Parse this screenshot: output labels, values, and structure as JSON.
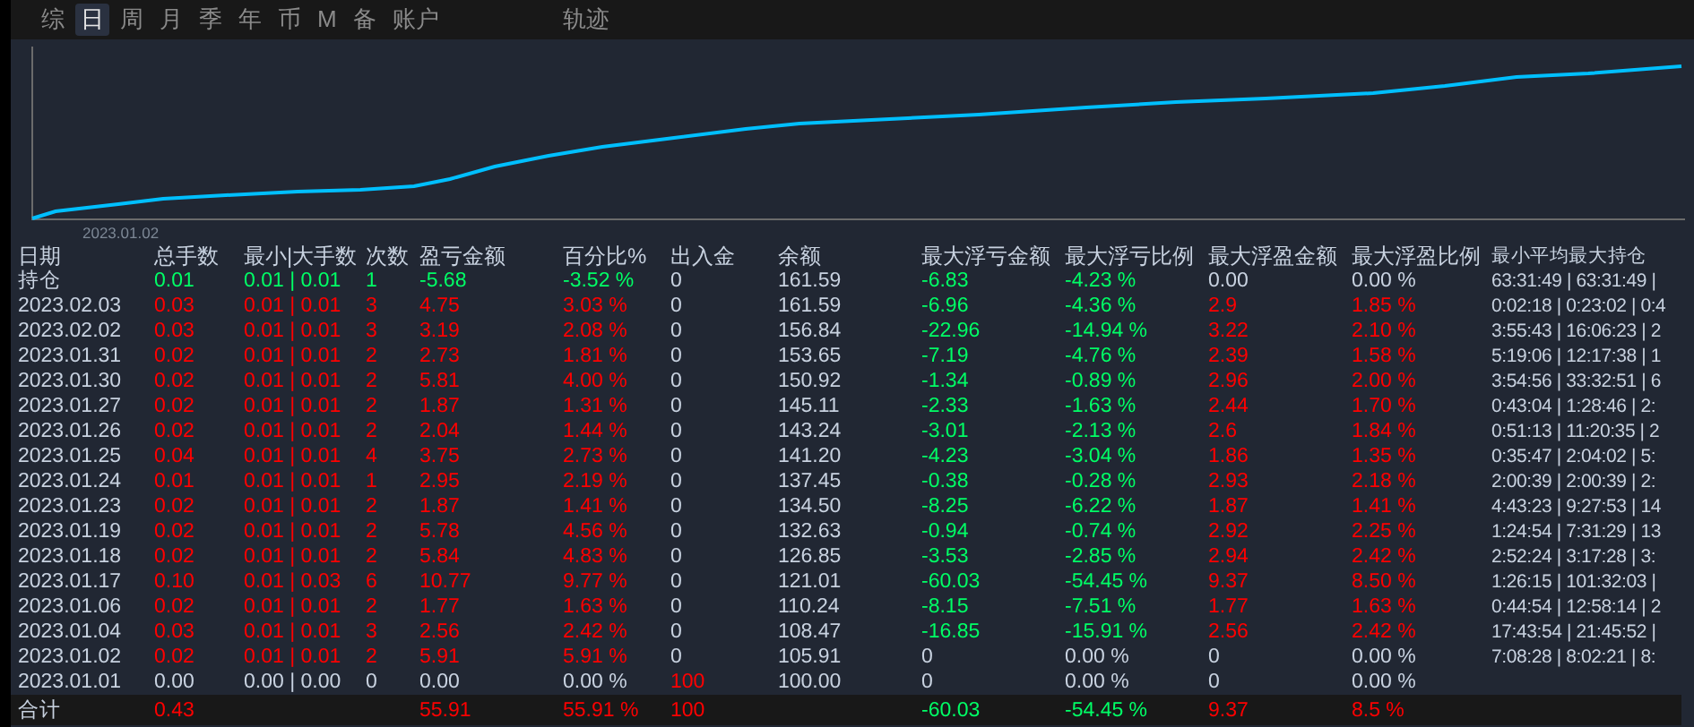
{
  "tabs": [
    {
      "label": "综",
      "selected": false
    },
    {
      "label": "日",
      "selected": true
    },
    {
      "label": "周",
      "selected": false
    },
    {
      "label": "月",
      "selected": false
    },
    {
      "label": "季",
      "selected": false
    },
    {
      "label": "年",
      "selected": false
    },
    {
      "label": "币",
      "selected": false
    },
    {
      "label": "M",
      "selected": false
    },
    {
      "label": "备",
      "selected": false
    },
    {
      "label": "账户",
      "selected": false
    }
  ],
  "side_tab": {
    "label": "轨迹",
    "selected": false
  },
  "chart": {
    "date_label": "2023.01.02"
  },
  "table": {
    "columns": [
      "日期",
      "总手数",
      "最小|大手数",
      "次数",
      "盈亏金额",
      "百分比%",
      "出入金",
      "余额",
      "最大浮亏金额",
      "最大浮亏比例",
      "最大浮盈金额",
      "最大浮盈比例",
      "最小平均最大持仓"
    ],
    "rows": [
      {
        "cells": [
          {
            "text": "持仓",
            "color": "#c8d2e0"
          },
          {
            "text": "0.01",
            "color": "#00ff66"
          },
          {
            "text": "0.01 | 0.01",
            "color": "#00ff66"
          },
          {
            "text": "1",
            "color": "#00ff66"
          },
          {
            "text": "-5.68",
            "color": "#00ff66"
          },
          {
            "text": "-3.52 %",
            "color": "#00ff66"
          },
          {
            "text": "0",
            "color": "#c8d2e0"
          },
          {
            "text": "161.59",
            "color": "#c8d2e0"
          },
          {
            "text": "-6.83",
            "color": "#00ff66"
          },
          {
            "text": "-4.23 %",
            "color": "#00ff66"
          },
          {
            "text": "0.00",
            "color": "#c8d2e0"
          },
          {
            "text": "0.00 %",
            "color": "#c8d2e0"
          },
          {
            "text": "63:31:49 | 63:31:49 |",
            "color": "#c8d2e0"
          }
        ]
      },
      {
        "cells": [
          {
            "text": "2023.02.03",
            "color": "#c8d2e0"
          },
          {
            "text": "0.03",
            "color": "#ff0000"
          },
          {
            "text": "0.01 | 0.01",
            "color": "#ff0000"
          },
          {
            "text": "3",
            "color": "#ff0000"
          },
          {
            "text": "4.75",
            "color": "#ff0000"
          },
          {
            "text": "3.03 %",
            "color": "#ff0000"
          },
          {
            "text": "0",
            "color": "#c8d2e0"
          },
          {
            "text": "161.59",
            "color": "#c8d2e0"
          },
          {
            "text": "-6.96",
            "color": "#00ff66"
          },
          {
            "text": "-4.36 %",
            "color": "#00ff66"
          },
          {
            "text": "2.9",
            "color": "#ff0000"
          },
          {
            "text": "1.85 %",
            "color": "#ff0000"
          },
          {
            "text": "0:02:18 | 0:23:02 | 0:4",
            "color": "#c8d2e0"
          }
        ]
      },
      {
        "cells": [
          {
            "text": "2023.02.02",
            "color": "#c8d2e0"
          },
          {
            "text": "0.03",
            "color": "#ff0000"
          },
          {
            "text": "0.01 | 0.01",
            "color": "#ff0000"
          },
          {
            "text": "3",
            "color": "#ff0000"
          },
          {
            "text": "3.19",
            "color": "#ff0000"
          },
          {
            "text": "2.08 %",
            "color": "#ff0000"
          },
          {
            "text": "0",
            "color": "#c8d2e0"
          },
          {
            "text": "156.84",
            "color": "#c8d2e0"
          },
          {
            "text": "-22.96",
            "color": "#00ff66"
          },
          {
            "text": "-14.94 %",
            "color": "#00ff66"
          },
          {
            "text": "3.22",
            "color": "#ff0000"
          },
          {
            "text": "2.10 %",
            "color": "#ff0000"
          },
          {
            "text": "3:55:43 | 16:06:23 | 2",
            "color": "#c8d2e0"
          }
        ]
      },
      {
        "cells": [
          {
            "text": "2023.01.31",
            "color": "#c8d2e0"
          },
          {
            "text": "0.02",
            "color": "#ff0000"
          },
          {
            "text": "0.01 | 0.01",
            "color": "#ff0000"
          },
          {
            "text": "2",
            "color": "#ff0000"
          },
          {
            "text": "2.73",
            "color": "#ff0000"
          },
          {
            "text": "1.81 %",
            "color": "#ff0000"
          },
          {
            "text": "0",
            "color": "#c8d2e0"
          },
          {
            "text": "153.65",
            "color": "#c8d2e0"
          },
          {
            "text": "-7.19",
            "color": "#00ff66"
          },
          {
            "text": "-4.76 %",
            "color": "#00ff66"
          },
          {
            "text": "2.39",
            "color": "#ff0000"
          },
          {
            "text": "1.58 %",
            "color": "#ff0000"
          },
          {
            "text": "5:19:06 | 12:17:38 | 1",
            "color": "#c8d2e0"
          }
        ]
      },
      {
        "cells": [
          {
            "text": "2023.01.30",
            "color": "#c8d2e0"
          },
          {
            "text": "0.02",
            "color": "#ff0000"
          },
          {
            "text": "0.01 | 0.01",
            "color": "#ff0000"
          },
          {
            "text": "2",
            "color": "#ff0000"
          },
          {
            "text": "5.81",
            "color": "#ff0000"
          },
          {
            "text": "4.00 %",
            "color": "#ff0000"
          },
          {
            "text": "0",
            "color": "#c8d2e0"
          },
          {
            "text": "150.92",
            "color": "#c8d2e0"
          },
          {
            "text": "-1.34",
            "color": "#00ff66"
          },
          {
            "text": "-0.89 %",
            "color": "#00ff66"
          },
          {
            "text": "2.96",
            "color": "#ff0000"
          },
          {
            "text": "2.00 %",
            "color": "#ff0000"
          },
          {
            "text": "3:54:56 | 33:32:51 | 6",
            "color": "#c8d2e0"
          }
        ]
      },
      {
        "cells": [
          {
            "text": "2023.01.27",
            "color": "#c8d2e0"
          },
          {
            "text": "0.02",
            "color": "#ff0000"
          },
          {
            "text": "0.01 | 0.01",
            "color": "#ff0000"
          },
          {
            "text": "2",
            "color": "#ff0000"
          },
          {
            "text": "1.87",
            "color": "#ff0000"
          },
          {
            "text": "1.31 %",
            "color": "#ff0000"
          },
          {
            "text": "0",
            "color": "#c8d2e0"
          },
          {
            "text": "145.11",
            "color": "#c8d2e0"
          },
          {
            "text": "-2.33",
            "color": "#00ff66"
          },
          {
            "text": "-1.63 %",
            "color": "#00ff66"
          },
          {
            "text": "2.44",
            "color": "#ff0000"
          },
          {
            "text": "1.70 %",
            "color": "#ff0000"
          },
          {
            "text": "0:43:04 | 1:28:46 | 2:",
            "color": "#c8d2e0"
          }
        ]
      },
      {
        "cells": [
          {
            "text": "2023.01.26",
            "color": "#c8d2e0"
          },
          {
            "text": "0.02",
            "color": "#ff0000"
          },
          {
            "text": "0.01 | 0.01",
            "color": "#ff0000"
          },
          {
            "text": "2",
            "color": "#ff0000"
          },
          {
            "text": "2.04",
            "color": "#ff0000"
          },
          {
            "text": "1.44 %",
            "color": "#ff0000"
          },
          {
            "text": "0",
            "color": "#c8d2e0"
          },
          {
            "text": "143.24",
            "color": "#c8d2e0"
          },
          {
            "text": "-3.01",
            "color": "#00ff66"
          },
          {
            "text": "-2.13 %",
            "color": "#00ff66"
          },
          {
            "text": "2.6",
            "color": "#ff0000"
          },
          {
            "text": "1.84 %",
            "color": "#ff0000"
          },
          {
            "text": "0:51:13 | 11:20:35 | 2",
            "color": "#c8d2e0"
          }
        ]
      },
      {
        "cells": [
          {
            "text": "2023.01.25",
            "color": "#c8d2e0"
          },
          {
            "text": "0.04",
            "color": "#ff0000"
          },
          {
            "text": "0.01 | 0.01",
            "color": "#ff0000"
          },
          {
            "text": "4",
            "color": "#ff0000"
          },
          {
            "text": "3.75",
            "color": "#ff0000"
          },
          {
            "text": "2.73 %",
            "color": "#ff0000"
          },
          {
            "text": "0",
            "color": "#c8d2e0"
          },
          {
            "text": "141.20",
            "color": "#c8d2e0"
          },
          {
            "text": "-4.23",
            "color": "#00ff66"
          },
          {
            "text": "-3.04 %",
            "color": "#00ff66"
          },
          {
            "text": "1.86",
            "color": "#ff0000"
          },
          {
            "text": "1.35 %",
            "color": "#ff0000"
          },
          {
            "text": "0:35:47 | 2:04:02 | 5:",
            "color": "#c8d2e0"
          }
        ]
      },
      {
        "cells": [
          {
            "text": "2023.01.24",
            "color": "#c8d2e0"
          },
          {
            "text": "0.01",
            "color": "#ff0000"
          },
          {
            "text": "0.01 | 0.01",
            "color": "#ff0000"
          },
          {
            "text": "1",
            "color": "#ff0000"
          },
          {
            "text": "2.95",
            "color": "#ff0000"
          },
          {
            "text": "2.19 %",
            "color": "#ff0000"
          },
          {
            "text": "0",
            "color": "#c8d2e0"
          },
          {
            "text": "137.45",
            "color": "#c8d2e0"
          },
          {
            "text": "-0.38",
            "color": "#00ff66"
          },
          {
            "text": "-0.28 %",
            "color": "#00ff66"
          },
          {
            "text": "2.93",
            "color": "#ff0000"
          },
          {
            "text": "2.18 %",
            "color": "#ff0000"
          },
          {
            "text": "2:00:39 | 2:00:39 | 2:",
            "color": "#c8d2e0"
          }
        ]
      },
      {
        "cells": [
          {
            "text": "2023.01.23",
            "color": "#c8d2e0"
          },
          {
            "text": "0.02",
            "color": "#ff0000"
          },
          {
            "text": "0.01 | 0.01",
            "color": "#ff0000"
          },
          {
            "text": "2",
            "color": "#ff0000"
          },
          {
            "text": "1.87",
            "color": "#ff0000"
          },
          {
            "text": "1.41 %",
            "color": "#ff0000"
          },
          {
            "text": "0",
            "color": "#c8d2e0"
          },
          {
            "text": "134.50",
            "color": "#c8d2e0"
          },
          {
            "text": "-8.25",
            "color": "#00ff66"
          },
          {
            "text": "-6.22 %",
            "color": "#00ff66"
          },
          {
            "text": "1.87",
            "color": "#ff0000"
          },
          {
            "text": "1.41 %",
            "color": "#ff0000"
          },
          {
            "text": "4:43:23 | 9:27:53 | 14",
            "color": "#c8d2e0"
          }
        ]
      },
      {
        "cells": [
          {
            "text": "2023.01.19",
            "color": "#c8d2e0"
          },
          {
            "text": "0.02",
            "color": "#ff0000"
          },
          {
            "text": "0.01 | 0.01",
            "color": "#ff0000"
          },
          {
            "text": "2",
            "color": "#ff0000"
          },
          {
            "text": "5.78",
            "color": "#ff0000"
          },
          {
            "text": "4.56 %",
            "color": "#ff0000"
          },
          {
            "text": "0",
            "color": "#c8d2e0"
          },
          {
            "text": "132.63",
            "color": "#c8d2e0"
          },
          {
            "text": "-0.94",
            "color": "#00ff66"
          },
          {
            "text": "-0.74 %",
            "color": "#00ff66"
          },
          {
            "text": "2.92",
            "color": "#ff0000"
          },
          {
            "text": "2.25 %",
            "color": "#ff0000"
          },
          {
            "text": "1:24:54 | 7:31:29 | 13",
            "color": "#c8d2e0"
          }
        ]
      },
      {
        "cells": [
          {
            "text": "2023.01.18",
            "color": "#c8d2e0"
          },
          {
            "text": "0.02",
            "color": "#ff0000"
          },
          {
            "text": "0.01 | 0.01",
            "color": "#ff0000"
          },
          {
            "text": "2",
            "color": "#ff0000"
          },
          {
            "text": "5.84",
            "color": "#ff0000"
          },
          {
            "text": "4.83 %",
            "color": "#ff0000"
          },
          {
            "text": "0",
            "color": "#c8d2e0"
          },
          {
            "text": "126.85",
            "color": "#c8d2e0"
          },
          {
            "text": "-3.53",
            "color": "#00ff66"
          },
          {
            "text": "-2.85 %",
            "color": "#00ff66"
          },
          {
            "text": "2.94",
            "color": "#ff0000"
          },
          {
            "text": "2.42 %",
            "color": "#ff0000"
          },
          {
            "text": "2:52:24 | 3:17:28 | 3:",
            "color": "#c8d2e0"
          }
        ]
      },
      {
        "cells": [
          {
            "text": "2023.01.17",
            "color": "#c8d2e0"
          },
          {
            "text": "0.10",
            "color": "#ff0000"
          },
          {
            "text": "0.01 | 0.03",
            "color": "#ff0000"
          },
          {
            "text": "6",
            "color": "#ff0000"
          },
          {
            "text": "10.77",
            "color": "#ff0000"
          },
          {
            "text": "9.77 %",
            "color": "#ff0000"
          },
          {
            "text": "0",
            "color": "#c8d2e0"
          },
          {
            "text": "121.01",
            "color": "#c8d2e0"
          },
          {
            "text": "-60.03",
            "color": "#00ff66"
          },
          {
            "text": "-54.45 %",
            "color": "#00ff66"
          },
          {
            "text": "9.37",
            "color": "#ff0000"
          },
          {
            "text": "8.50 %",
            "color": "#ff0000"
          },
          {
            "text": "1:26:15 | 101:32:03 |",
            "color": "#c8d2e0"
          }
        ]
      },
      {
        "cells": [
          {
            "text": "2023.01.06",
            "color": "#c8d2e0"
          },
          {
            "text": "0.02",
            "color": "#ff0000"
          },
          {
            "text": "0.01 | 0.01",
            "color": "#ff0000"
          },
          {
            "text": "2",
            "color": "#ff0000"
          },
          {
            "text": "1.77",
            "color": "#ff0000"
          },
          {
            "text": "1.63 %",
            "color": "#ff0000"
          },
          {
            "text": "0",
            "color": "#c8d2e0"
          },
          {
            "text": "110.24",
            "color": "#c8d2e0"
          },
          {
            "text": "-8.15",
            "color": "#00ff66"
          },
          {
            "text": "-7.51 %",
            "color": "#00ff66"
          },
          {
            "text": "1.77",
            "color": "#ff0000"
          },
          {
            "text": "1.63 %",
            "color": "#ff0000"
          },
          {
            "text": "0:44:54 | 12:58:14 | 2",
            "color": "#c8d2e0"
          }
        ]
      },
      {
        "cells": [
          {
            "text": "2023.01.04",
            "color": "#c8d2e0"
          },
          {
            "text": "0.03",
            "color": "#ff0000"
          },
          {
            "text": "0.01 | 0.01",
            "color": "#ff0000"
          },
          {
            "text": "3",
            "color": "#ff0000"
          },
          {
            "text": "2.56",
            "color": "#ff0000"
          },
          {
            "text": "2.42 %",
            "color": "#ff0000"
          },
          {
            "text": "0",
            "color": "#c8d2e0"
          },
          {
            "text": "108.47",
            "color": "#c8d2e0"
          },
          {
            "text": "-16.85",
            "color": "#00ff66"
          },
          {
            "text": "-15.91 %",
            "color": "#00ff66"
          },
          {
            "text": "2.56",
            "color": "#ff0000"
          },
          {
            "text": "2.42 %",
            "color": "#ff0000"
          },
          {
            "text": "17:43:54 | 21:45:52 |",
            "color": "#c8d2e0"
          }
        ]
      },
      {
        "cells": [
          {
            "text": "2023.01.02",
            "color": "#c8d2e0"
          },
          {
            "text": "0.02",
            "color": "#ff0000"
          },
          {
            "text": "0.01 | 0.01",
            "color": "#ff0000"
          },
          {
            "text": "2",
            "color": "#ff0000"
          },
          {
            "text": "5.91",
            "color": "#ff0000"
          },
          {
            "text": "5.91 %",
            "color": "#ff0000"
          },
          {
            "text": "0",
            "color": "#c8d2e0"
          },
          {
            "text": "105.91",
            "color": "#c8d2e0"
          },
          {
            "text": "0",
            "color": "#c8d2e0"
          },
          {
            "text": "0.00 %",
            "color": "#c8d2e0"
          },
          {
            "text": "0",
            "color": "#c8d2e0"
          },
          {
            "text": "0.00 %",
            "color": "#c8d2e0"
          },
          {
            "text": "7:08:28 | 8:02:21 | 8:",
            "color": "#c8d2e0"
          }
        ]
      },
      {
        "cells": [
          {
            "text": "2023.01.01",
            "color": "#c8d2e0"
          },
          {
            "text": "0.00",
            "color": "#c8d2e0"
          },
          {
            "text": "0.00 | 0.00",
            "color": "#c8d2e0"
          },
          {
            "text": "0",
            "color": "#c8d2e0"
          },
          {
            "text": "0.00",
            "color": "#c8d2e0"
          },
          {
            "text": "0.00 %",
            "color": "#c8d2e0"
          },
          {
            "text": "100",
            "color": "#ff0000"
          },
          {
            "text": "100.00",
            "color": "#c8d2e0"
          },
          {
            "text": "0",
            "color": "#c8d2e0"
          },
          {
            "text": "0.00 %",
            "color": "#c8d2e0"
          },
          {
            "text": "0",
            "color": "#c8d2e0"
          },
          {
            "text": "0.00 %",
            "color": "#c8d2e0"
          }
        ]
      }
    ],
    "total": {
      "cells": [
        {
          "text": "合计",
          "color": "#c8d2e0"
        },
        {
          "text": "0.43",
          "color": "#ff0000"
        },
        null,
        null,
        {
          "text": "55.91",
          "color": "#ff0000"
        },
        {
          "text": "55.91 %",
          "color": "#ff0000"
        },
        {
          "text": "100",
          "color": "#ff0000"
        },
        null,
        {
          "text": "-60.03",
          "color": "#00ff66"
        },
        {
          "text": "-54.45 %",
          "color": "#00ff66"
        },
        {
          "text": "9.37",
          "color": "#ff0000"
        },
        {
          "text": "8.5 %",
          "color": "#ff0000"
        }
      ]
    }
  }
}
